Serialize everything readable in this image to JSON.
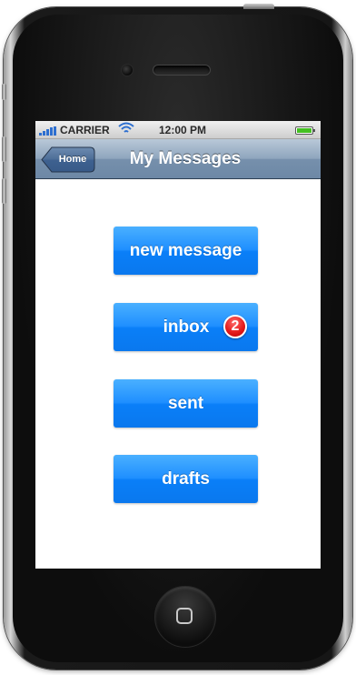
{
  "status_bar": {
    "carrier": "CARRIER",
    "time": "12:00 PM",
    "battery_color": "#44c022",
    "icons": [
      "signal-bars-icon",
      "wifi-icon",
      "battery-icon"
    ]
  },
  "nav": {
    "back_label": "Home",
    "title": "My Messages"
  },
  "buttons": {
    "new_message": "new message",
    "inbox": "inbox",
    "inbox_badge": "2",
    "sent": "sent",
    "drafts": "drafts"
  },
  "colors": {
    "button_blue": "#1f8fff",
    "badge_red": "#e51c1c",
    "nav_blue": "#7690ac"
  }
}
